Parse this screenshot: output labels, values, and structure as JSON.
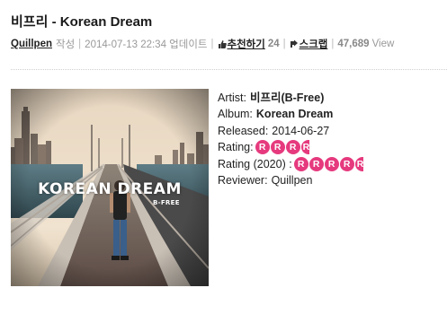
{
  "post": {
    "title": "비프리 - Korean Dream",
    "author": "Quillpen",
    "author_suffix": "작성",
    "timestamp": "2014-07-13 22:34 업데이트",
    "recommend_label": "추천하기",
    "recommend_count": "24",
    "scrap_label": "스크랩",
    "views": "47,689",
    "views_label": "View"
  },
  "cover": {
    "title": "KOREAN DREAM",
    "artist": "B-FREE"
  },
  "album_info": {
    "artist_label": "Artist:",
    "artist_value": "비프리(B-Free)",
    "album_label": "Album:",
    "album_value": "Korean Dream",
    "released_label": "Released:",
    "released_value": "2014-06-27",
    "rating_label": "Rating:",
    "rating_2020_label": "Rating (2020) :",
    "rating_icon_letter": "R",
    "reviewer_label": "Reviewer:",
    "reviewer_value": "Quillpen"
  },
  "ratings": {
    "rating": 3.5,
    "rating_2020": 4.5,
    "badge_color": "#e63a7e"
  },
  "icons": {
    "recommend": "thumbs-up-icon",
    "scrap": "scrap-arrow-icon"
  }
}
